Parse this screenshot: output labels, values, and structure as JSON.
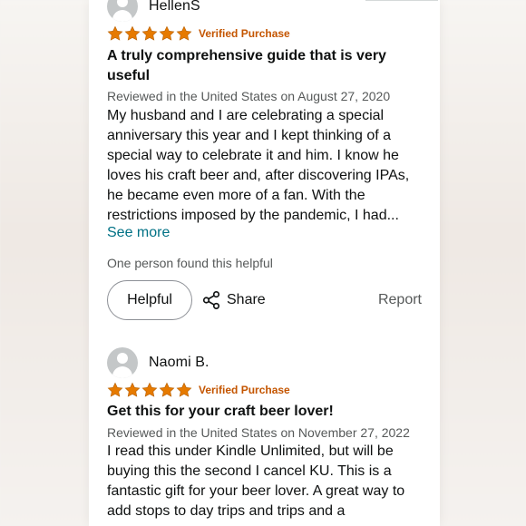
{
  "reviews": [
    {
      "username": "HellenS",
      "verified_label": "Verified Purchase",
      "title": "A truly comprehensive guide that is very useful",
      "meta": "Reviewed in the United States on August 27, 2020",
      "body": "My husband and I are celebrating a special anniversary this year and I kept thinking of a special way to celebrate it and him. I know he loves his craft beer and, after discovering IPAs, he became even more of a fan. With the restrictions imposed by the pandemic, I had...",
      "see_more": "See more",
      "helpful_text": "One person found this helpful",
      "helpful_button": "Helpful",
      "share_label": "Share",
      "report_label": "Report",
      "rating": 5
    },
    {
      "username": "Naomi B.",
      "verified_label": "Verified Purchase",
      "title": "Get this for your craft beer lover!",
      "meta": "Reviewed in the United States on November 27, 2022",
      "body": "I read this under Kindle Unlimited, but will be buying this the second I cancel KU. This is a fantastic gift for your beer lover. A great way to add stops to day trips and trips and a",
      "rating": 5
    }
  ],
  "colors": {
    "star": "#e67a00",
    "verified": "#c45500",
    "link": "#007185",
    "muted": "#565959"
  }
}
